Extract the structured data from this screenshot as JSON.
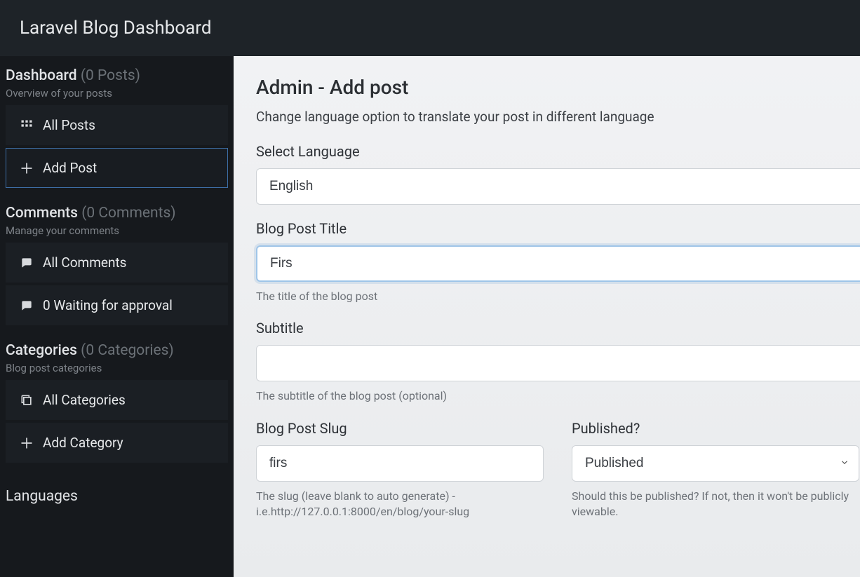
{
  "app_title": "Laravel Blog Dashboard",
  "sidebar": {
    "sections": [
      {
        "title": "Dashboard",
        "count_label": "(0 Posts)",
        "subtitle": "Overview of your posts",
        "items": [
          {
            "label": "All Posts",
            "icon": "grid-icon"
          },
          {
            "label": "Add Post",
            "icon": "plus-icon",
            "active": true
          }
        ]
      },
      {
        "title": "Comments",
        "count_label": "(0 Comments)",
        "subtitle": "Manage your comments",
        "items": [
          {
            "label": "All Comments",
            "icon": "comments-icon"
          },
          {
            "label": "0 Waiting for approval",
            "icon": "comments-icon"
          }
        ]
      },
      {
        "title": "Categories",
        "count_label": "(0 Categories)",
        "subtitle": "Blog post categories",
        "items": [
          {
            "label": "All Categories",
            "icon": "group-icon"
          },
          {
            "label": "Add Category",
            "icon": "plus-icon"
          }
        ]
      }
    ],
    "languages_label": "Languages"
  },
  "main": {
    "title": "Admin - Add post",
    "description": "Change language option to translate your post in different language",
    "fields": {
      "language": {
        "label": "Select Language",
        "value": "English"
      },
      "post_title": {
        "label": "Blog Post Title",
        "value": "Firs",
        "help": "The title of the blog post"
      },
      "subtitle": {
        "label": "Subtitle",
        "value": "",
        "help": "The subtitle of the blog post (optional)"
      },
      "slug": {
        "label": "Blog Post Slug",
        "value": "firs",
        "help": "The slug (leave blank to auto generate) - i.e.http://127.0.0.1:8000/en/blog/your-slug"
      },
      "published": {
        "label": "Published?",
        "value": "Published",
        "help": "Should this be published? If not, then it won't be publicly viewable."
      }
    }
  }
}
